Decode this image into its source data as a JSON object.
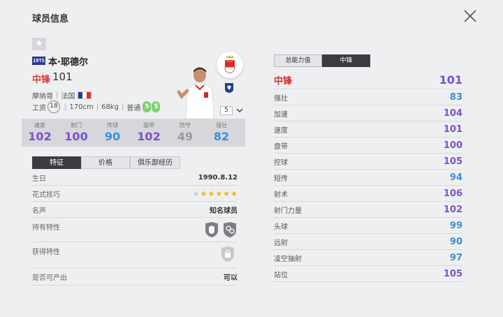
{
  "header": {
    "title": "球员信息"
  },
  "player": {
    "season_badge": "19TS",
    "name": "本·耶德尔",
    "position": "中锋",
    "overall": "101",
    "club": "摩纳哥",
    "nation": "法国",
    "salary_label": "工资",
    "salary": "18",
    "height": "170cm",
    "weight": "68kg",
    "body": "普通",
    "weak_foot_left": "5",
    "weak_foot_right": "5",
    "level": "5"
  },
  "colors": {
    "purple": "#7a4fd8",
    "blue": "#3a8de0",
    "gray": "#9a9a9a",
    "red": "#d62b2b"
  },
  "stats": [
    {
      "label": "速度",
      "value": "102",
      "color": "#7a4fd8"
    },
    {
      "label": "射门",
      "value": "100",
      "color": "#7a4fd8"
    },
    {
      "label": "传球",
      "value": "90",
      "color": "#3a8de0"
    },
    {
      "label": "盘带",
      "value": "102",
      "color": "#7a4fd8"
    },
    {
      "label": "防守",
      "value": "49",
      "color": "#9a9a9a"
    },
    {
      "label": "强壮",
      "value": "82",
      "color": "#3a8de0"
    }
  ],
  "left_tabs": [
    "特征",
    "价格",
    "俱乐部经历"
  ],
  "info": {
    "birthday_label": "生日",
    "birthday": "1990.8.12",
    "skill_label": "花式技巧",
    "skill_stars": 5,
    "fame_label": "名声",
    "fame": "知名球员",
    "traits_label": "持有特性",
    "acquired_label": "获得特性",
    "produce_label": "是否可产出",
    "produce": "可以"
  },
  "right_tabs": [
    "总能力值",
    "中锋"
  ],
  "attributes": [
    {
      "label": "中锋",
      "value": "101",
      "color": "#7a4fd8"
    },
    {
      "label": "强壮",
      "value": "83",
      "color": "#3a8de0"
    },
    {
      "label": "加速",
      "value": "104",
      "color": "#7a4fd8"
    },
    {
      "label": "速度",
      "value": "101",
      "color": "#7a4fd8"
    },
    {
      "label": "盘带",
      "value": "100",
      "color": "#7a4fd8"
    },
    {
      "label": "控球",
      "value": "105",
      "color": "#7a4fd8"
    },
    {
      "label": "短传",
      "value": "94",
      "color": "#3a8de0"
    },
    {
      "label": "射术",
      "value": "106",
      "color": "#7a4fd8"
    },
    {
      "label": "射门力量",
      "value": "102",
      "color": "#7a4fd8"
    },
    {
      "label": "头球",
      "value": "99",
      "color": "#3a8de0"
    },
    {
      "label": "远射",
      "value": "90",
      "color": "#3a8de0"
    },
    {
      "label": "凌空抽射",
      "value": "97",
      "color": "#3a8de0"
    },
    {
      "label": "站位",
      "value": "105",
      "color": "#7a4fd8"
    }
  ]
}
